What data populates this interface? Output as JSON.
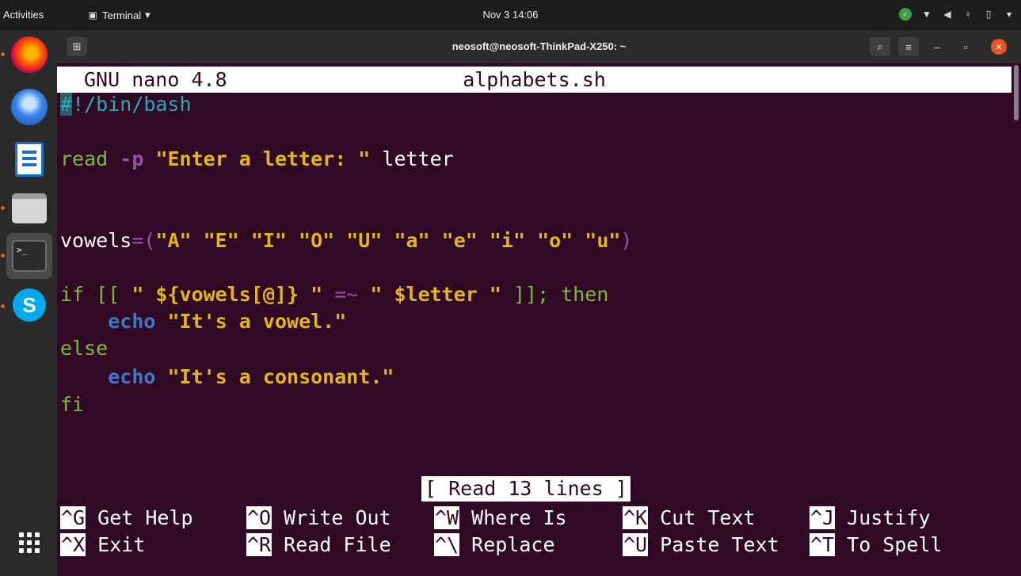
{
  "topbar": {
    "activities": "Activities",
    "app_menu": "Terminal",
    "clock": "Nov 3  14:06"
  },
  "window": {
    "title": "neosoft@neosoft-ThinkPad-X250: ~"
  },
  "nano": {
    "version": "GNU nano 4.8",
    "filename": "alphabets.sh",
    "status": "[ Read 13 lines ]",
    "code": {
      "l1_a": "#",
      "l1_b": "!/bin/bash",
      "l3_a": "read ",
      "l3_b": "-p",
      "l3_c": " ",
      "l3_d": "\"Enter a letter: \"",
      "l3_e": " letter",
      "l6_a": "vowels",
      "l6_b": "=(",
      "l6_c": "\"A\" \"E\" \"I\" \"O\" \"U\" \"a\" \"e\" \"i\" \"o\" \"u\"",
      "l6_d": ")",
      "l8_a": "if [[ ",
      "l8_b": "\" ${vowels[@]} \"",
      "l8_c": " =~ ",
      "l8_d": "\" $letter \"",
      "l8_e": " ]]; then",
      "l9_indent": "    ",
      "l9_a": "echo",
      "l9_b": " ",
      "l9_c": "\"It's a vowel.\"",
      "l10": "else",
      "l11_indent": "    ",
      "l11_a": "echo",
      "l11_b": " ",
      "l11_c": "\"It's a consonant.\"",
      "l12": "fi"
    },
    "shortcuts": [
      {
        "key": "^G",
        "label": " Get Help"
      },
      {
        "key": "^O",
        "label": " Write Out"
      },
      {
        "key": "^W",
        "label": " Where Is"
      },
      {
        "key": "^K",
        "label": " Cut Text"
      },
      {
        "key": "^J",
        "label": " Justify"
      },
      {
        "key": "^X",
        "label": " Exit"
      },
      {
        "key": "^R",
        "label": " Read File"
      },
      {
        "key": "^\\",
        "label": " Replace"
      },
      {
        "key": "^U",
        "label": " Paste Text"
      },
      {
        "key": "^T",
        "label": " To Spell"
      }
    ]
  },
  "dock": {
    "terminal_glyph": ">_",
    "skype_glyph": "S"
  },
  "icons": {
    "app_menu_caret": "▾",
    "search": "⌕",
    "menu": "≡",
    "minimize": "–",
    "maximize": "▫",
    "close": "✕"
  },
  "colors": {
    "terminal_bg": "#300a24",
    "keyword": "#7cbb3a",
    "string": "#e3b61c",
    "comment": "#2ba9b7",
    "builtin": "#3d79c7",
    "accent": "#e95420"
  }
}
